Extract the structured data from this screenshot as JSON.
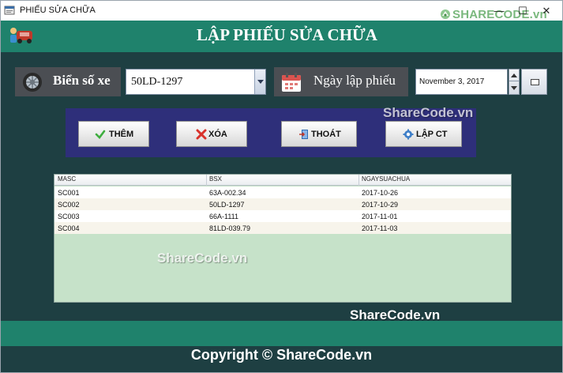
{
  "window": {
    "title": "PHIẾU SỬA CHỮA",
    "logo_text": "SHARECODE.vn",
    "controls": {
      "minimize": "—",
      "maximize": "☐",
      "close": "✕"
    }
  },
  "header": {
    "title": "LẬP PHIẾU SỬA CHỮA",
    "color": "#1f826c"
  },
  "form": {
    "plate_label": "Biển số xe",
    "plate_value": "50LD-1297",
    "date_label": "Ngày lập phiếu",
    "date_value": "November 3, 2017"
  },
  "buttons": {
    "add": "THÊM",
    "delete": "XÓA",
    "exit": "THOÁT",
    "create_detail": "LẬP CT"
  },
  "table": {
    "columns": [
      "MASC",
      "BSX",
      "NGAYSUACHUA"
    ],
    "rows": [
      [
        "SC001",
        "63A-002.34",
        "2017-10-26"
      ],
      [
        "SC002",
        "50LD-1297",
        "2017-10-29"
      ],
      [
        "SC003",
        "66A-1111",
        "2017-11-01"
      ],
      [
        "SC004",
        "81LD-039.79",
        "2017-11-03"
      ]
    ]
  },
  "watermarks": [
    "ShareCode.vn",
    "ShareCode.vn",
    "ShareCode.vn"
  ],
  "copyright": "Copyright © ShareCode.vn",
  "colors": {
    "accent": "#1f826c",
    "background": "#1e3f42",
    "button_panel": "#2e2f7a",
    "table_bg": "#c6e2c9"
  }
}
